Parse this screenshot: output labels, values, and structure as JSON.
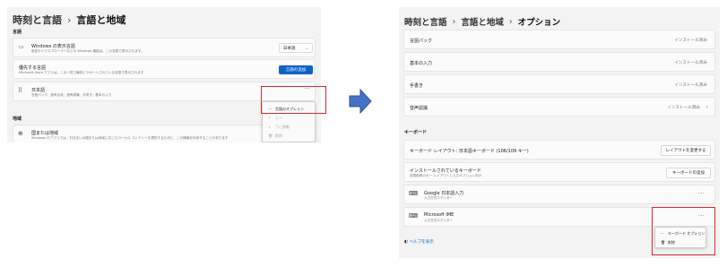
{
  "left": {
    "breadcrumb": {
      "prev": "時刻と言語",
      "sep": "›",
      "current": "言語と地域"
    },
    "section_language": "言語",
    "display_language": {
      "icon": "monitor-icon",
      "title": "Windows の表示言語",
      "subtitle": "設定やエクスプローラーなどの Windows 機能は、この言語で表示されます。",
      "value": "日本語"
    },
    "preferred": {
      "title": "優先する言語",
      "subtitle": "Microsoft Store アプリは、この一覧で最初にサポートされている言語で表示されます",
      "button": "言語の追加"
    },
    "japanese": {
      "icon": "drag-handle-icon",
      "title": "日本語",
      "subtitle": "言語パック、音声合成、音声認識、手書き、基本の入力",
      "more": "···"
    },
    "context_menu": {
      "items": [
        {
          "icon": "···",
          "label": "言語のオプション",
          "enabled": true
        },
        {
          "icon": "↑",
          "label": "上へ",
          "enabled": false
        },
        {
          "icon": "↓",
          "label": "下に移動",
          "enabled": false
        },
        {
          "icon": "🗑",
          "label": "削除",
          "enabled": false
        }
      ]
    },
    "section_region": "地域",
    "region": {
      "icon": "globe-icon",
      "title": "国または地域",
      "subtitle": "Windows やアプリでは、お住まいの国または地域に応じたローカル コンテンツを提供するために、この情報を利用することがあります"
    }
  },
  "right": {
    "breadcrumb": {
      "first": "時刻と言語",
      "sep": "›",
      "second": "言語と地域",
      "current": "オプション"
    },
    "rows": [
      {
        "label": "言語パック",
        "status": "インストール済み"
      },
      {
        "label": "基本の入力",
        "status": "インストール済み"
      },
      {
        "label": "手書き",
        "status": "インストール済み"
      },
      {
        "label": "音声認識",
        "status": "インストール済み",
        "chevron": "›"
      }
    ],
    "section_keyboard": "キーボード",
    "keyboard_layout": {
      "title": "キーボード レイアウト: 日本語キーボード (106/109 キー)",
      "button": "レイアウトを変更する"
    },
    "installed_keyboards": {
      "title": "インストールされているキーボード",
      "subtitle": "言語固有のキー レイアウトと入力オプション向け",
      "button": "キーボードの追加"
    },
    "google_ime": {
      "title": "Google 日本語入力",
      "subtitle": "入力方式エディター",
      "more": "···"
    },
    "ms_ime": {
      "title": "Microsoft IME",
      "subtitle": "入力方式エディター",
      "more": "···"
    },
    "context_menu": {
      "items": [
        {
          "icon": "···",
          "label": "キーボード オプション"
        },
        {
          "icon": "🗑",
          "label": "削除"
        }
      ]
    },
    "help": "ヘルプを表示"
  },
  "colors": {
    "accent": "#0f62c6",
    "highlight": "#d8292f",
    "arrow": "#4472c4"
  }
}
